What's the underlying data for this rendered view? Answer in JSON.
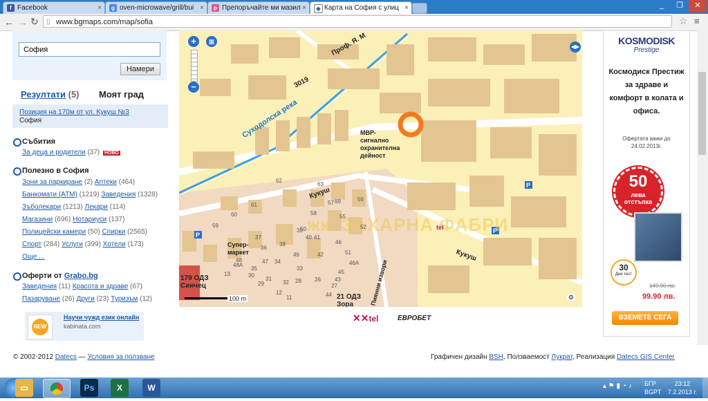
{
  "browser": {
    "tabs": [
      {
        "label": "Facebook",
        "active": false
      },
      {
        "label": "oven-microwave/grill/bui",
        "active": false
      },
      {
        "label": "Препоръчайте ми мазил",
        "active": false
      },
      {
        "label": "Карта на София с улиц",
        "active": true
      }
    ],
    "url": "www.bgmaps.com/map/sofia"
  },
  "search": {
    "value": "София",
    "find_label": "Намери"
  },
  "results_tab": "Резултати",
  "results_count": "(5)",
  "mycity_tab": "Моят град",
  "position": {
    "line1": "Позиция на 170м от ул. Кукуш №3",
    "line2": "София"
  },
  "events": {
    "title": "Събития",
    "item": "За деца и родители",
    "count": "(37)",
    "badge": "НОВО"
  },
  "useful": {
    "title": "Полезно в София",
    "rows": [
      [
        [
          "Зони за паркиране",
          "(2)"
        ],
        [
          "Аптеки",
          "(464)"
        ]
      ],
      [
        [
          "Банкомати (АТМ)",
          "(1219)"
        ],
        [
          "Заведения",
          "(1328)"
        ]
      ],
      [
        [
          "Зъболекари",
          "(1213)"
        ],
        [
          "Лекари",
          "(114)"
        ]
      ],
      [
        [
          "Магазини",
          "(696)"
        ],
        [
          "Нотариуси",
          "(137)"
        ]
      ],
      [
        [
          "Полицейски камери",
          "(50)"
        ],
        [
          "Спирки",
          "(2565)"
        ]
      ],
      [
        [
          "Спорт",
          "(284)"
        ],
        [
          "Услуги",
          "(399)"
        ],
        [
          "Хотели",
          "(173)"
        ]
      ]
    ],
    "more": "Още ..."
  },
  "offers": {
    "title": "Оферти от",
    "brand": "Grabo.bg",
    "rows": [
      [
        [
          "Заведения",
          "(11)"
        ],
        [
          "Красота и здраве",
          "(67)"
        ]
      ],
      [
        [
          "Пазаруване",
          "(26)"
        ],
        [
          "Други",
          "(23)"
        ],
        [
          "Туризъм",
          "(12)"
        ]
      ]
    ]
  },
  "ad_small": {
    "badge": "NEW",
    "title": "Научи чужд език онлайн",
    "site": "kabinata.com"
  },
  "map": {
    "labels": {
      "street1": "3019",
      "street2": "Проф. Я. М",
      "river": "Суходолска река",
      "mvr": "МВР-сигнално охранителна дейност",
      "kukush1": "Кукуш",
      "kukush2": "Кукуш",
      "super": "Супер- маркет",
      "district": "жк. ЗАХАРНА ФАБРИ",
      "school1": "179 ОДЗ",
      "school1b": "Синчец",
      "school2": "21 ОДЗ",
      "school2b": "Зора",
      "street3": "Пиянни извори",
      "scale": "100 m",
      "tel": "tel"
    },
    "numbers": [
      "62",
      "63",
      "61",
      "69",
      "56",
      "60",
      "59",
      "55",
      "50",
      "37",
      "40",
      "39",
      "38",
      "49",
      "34",
      "33",
      "41",
      "46",
      "42",
      "51",
      "36",
      "47",
      "48",
      "48А",
      "35",
      "30",
      "31",
      "32",
      "29",
      "28",
      "26",
      "27",
      "13",
      "12",
      "11",
      "46А",
      "45",
      "43",
      "44",
      "52",
      "57",
      "58"
    ],
    "sponsors": [
      "tel",
      "ЕВРОБЕТ"
    ]
  },
  "right_ad": {
    "brand": "KOSMODISK",
    "brand_sub": "Prestige",
    "headline": "Космодиск Престиж за здраве и комфорт в колата и офиса.",
    "valid": "Офертата важи до 24.02.2013г.",
    "discount_value": "50",
    "discount_unit": "лева",
    "discount_label": "отстъпка",
    "days_value": "30",
    "days_label": "Дни тест",
    "old_price": "149.90 лв.",
    "new_price": "99.90 лв.",
    "cta": "ВЗЕМЕТЕ СЕГА"
  },
  "footer": {
    "copyright": "© 2002-2012",
    "datecs": "Datecs",
    "dash": "—",
    "terms": "Условия за ползване",
    "design_label": "Графичен дизайн",
    "bsh": "BSH",
    "usability_label": ", Ползваемост",
    "lukrat": "Лукрат",
    "realization_label": ", Реализация",
    "datecs_gis": "Datecs GIS Center"
  },
  "taskbar": {
    "lang1": "БГР",
    "lang2": "BGPT",
    "time": "23:12",
    "date": "7.2.2013 г."
  },
  "colors": {
    "accent": "#1b59a6",
    "map_bg": "#fbf0b8",
    "river": "#3aa0e8",
    "marker": "#f37a1f",
    "building": "#e8c58e"
  }
}
